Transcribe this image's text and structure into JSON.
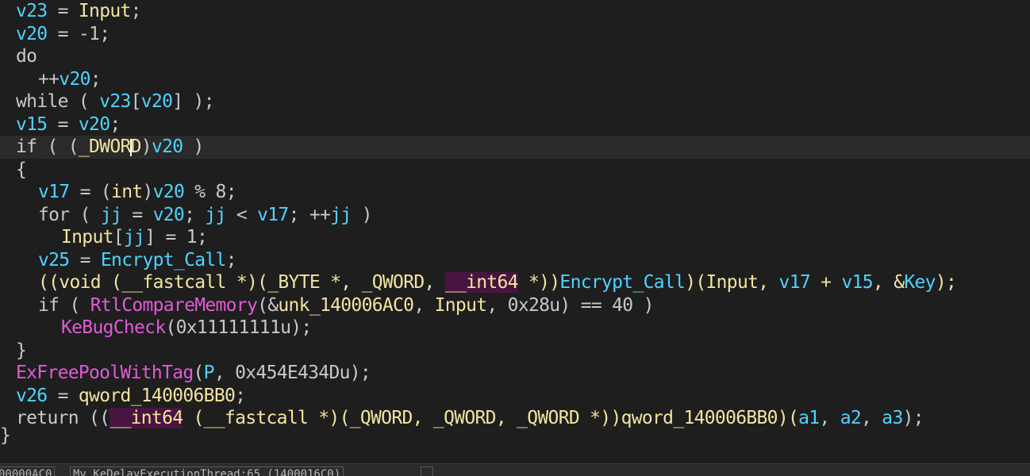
{
  "code": {
    "lines": [
      [
        "v23",
        " = ",
        "Input",
        ";"
      ],
      [
        "v20",
        " = -1;"
      ],
      [
        "do"
      ],
      [
        "++",
        "v20",
        ";"
      ],
      [
        "while ( ",
        "v23",
        "[",
        "v20",
        "] );"
      ],
      [
        "v15",
        " = ",
        "v20",
        ";"
      ],
      [
        "if ( (",
        "_DWOR",
        "D",
        ")",
        "v20",
        " )"
      ],
      [
        "{"
      ],
      [
        "v17",
        " = (",
        "int",
        ")",
        "v20",
        " % 8;"
      ],
      [
        "for ( ",
        "jj",
        " = ",
        "v20",
        "; ",
        "jj",
        " < ",
        "v17",
        "; ++",
        "jj",
        " )"
      ],
      [
        "Input",
        "[",
        "jj",
        "] = 1;"
      ],
      [
        "v25",
        " = ",
        "Encrypt_Call",
        ";"
      ],
      [
        "((",
        "void",
        " (",
        "__fastcall",
        " *)(",
        "_BYTE",
        " *, ",
        "_QWORD",
        ", ",
        "__int64",
        " *))",
        "Encrypt_Call",
        ")(",
        "Input",
        ", ",
        "v17",
        " + ",
        "v15",
        ", &",
        "Key",
        ");"
      ],
      [
        "if ( ",
        "RtlCompareMemory",
        "(&",
        "unk_140006AC0",
        ", ",
        "Input",
        ", 0x28u) == 40 )"
      ],
      [
        "KeBugCheck",
        "(0x11111111u);"
      ],
      [
        "}"
      ],
      [
        "ExFreePoolWithTag",
        "(",
        "P",
        ", 0x454E434Du);"
      ],
      [
        "v26",
        " = ",
        "qword_140006BB0",
        ";"
      ],
      [
        "return ((",
        "__int64",
        " (",
        "__fastcall",
        " *)(",
        "_QWORD",
        ", ",
        "_QWORD",
        ", ",
        "_QWORD",
        " *))",
        "qword_140006BB0",
        ")(",
        "a1",
        ", ",
        "a2",
        ", ",
        "a3",
        ");"
      ],
      [
        "}"
      ]
    ]
  },
  "statusbar": {
    "address": "00000AC0",
    "location": "My_KeDelayExecutionThread:65 (1400016C0)"
  },
  "colors": {
    "background": "#1e1e1e",
    "variable": "#4fd3ff",
    "identifier": "#f2e4a0",
    "function": "#e05bd6",
    "plain": "#c8c8c8",
    "highlight": "#4a1440"
  }
}
